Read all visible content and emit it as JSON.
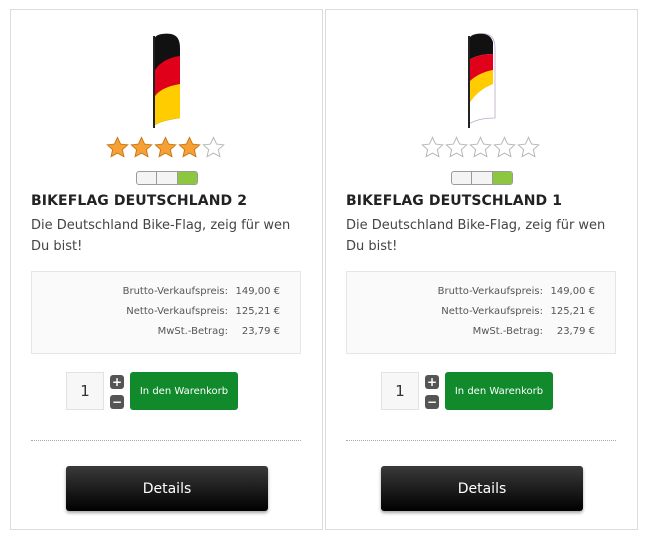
{
  "products": [
    {
      "title": "BIKEFLAG DEUTSCHLAND 2",
      "description": "Die Deutschland Bike-Flag, zeig für wen Du bist!",
      "rating": 4,
      "rating_max": 5,
      "stock_level_segments_on": 1,
      "stock_level_segments": 3,
      "prices": [
        {
          "label": "Brutto-Verkaufspreis:",
          "value": "149,00 €"
        },
        {
          "label": "Netto-Verkaufspreis:",
          "value": "125,21 €"
        },
        {
          "label": "MwSt.-Betrag:",
          "value": "23,79 €"
        }
      ],
      "quantity": "1",
      "cart_label": "In den Warenkorb",
      "details_label": "Details"
    },
    {
      "title": "BIKEFLAG DEUTSCHLAND 1",
      "description": "Die Deutschland Bike-Flag, zeig für wen Du bist!",
      "rating": 0,
      "rating_max": 5,
      "stock_level_segments_on": 1,
      "stock_level_segments": 3,
      "prices": [
        {
          "label": "Brutto-Verkaufspreis:",
          "value": "149,00 €"
        },
        {
          "label": "Netto-Verkaufspreis:",
          "value": "125,21 €"
        },
        {
          "label": "MwSt.-Betrag:",
          "value": "23,79 €"
        }
      ],
      "quantity": "1",
      "cart_label": "In den Warenkorb",
      "details_label": "Details"
    }
  ],
  "icons": {
    "plus": "plus-icon",
    "minus": "minus-icon",
    "star": "star-icon"
  },
  "colors": {
    "cart_button": "#118a2c",
    "details_button": "#000000",
    "star_filled": "#f7a035",
    "stock_on": "#8dc63f"
  }
}
